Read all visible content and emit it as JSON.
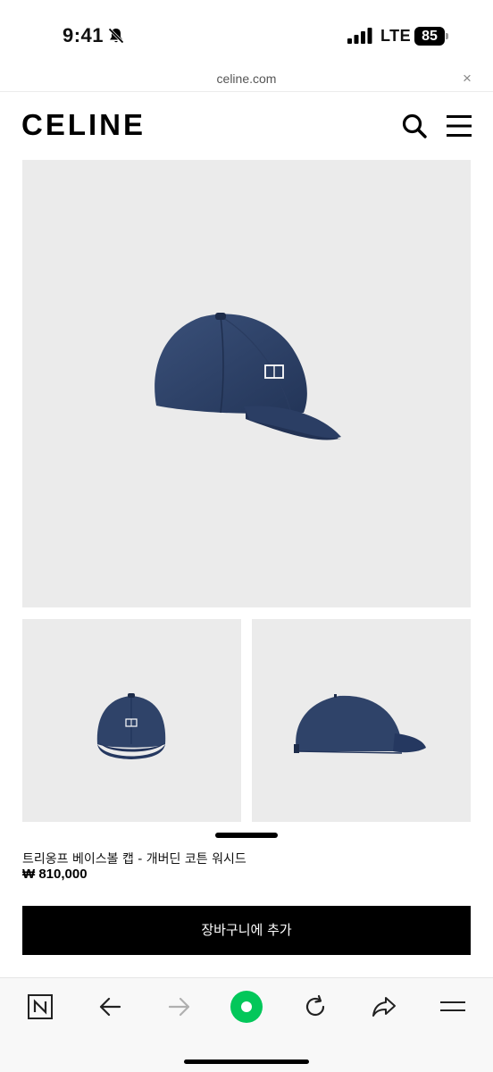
{
  "status_bar": {
    "time": "9:41",
    "network": "LTE",
    "battery": "85",
    "icons": [
      "bell-slash-icon",
      "signal-icon",
      "battery-icon"
    ]
  },
  "browser": {
    "url": "celine.com",
    "close_glyph": "×",
    "toolbar_icons": [
      "n-logo-icon",
      "back-arrow-icon",
      "forward-arrow-icon",
      "home-circle-icon",
      "reload-icon",
      "share-icon",
      "menu-icon"
    ]
  },
  "header": {
    "logo": "CELINE",
    "icons": [
      "search-icon",
      "hamburger-menu-icon"
    ]
  },
  "product": {
    "name": "트리옹프 베이스볼 캡 - 개버딘 코튼 워시드",
    "price": "₩ 810,000",
    "add_to_cart_label": "장바구니에 추가",
    "image_color": "#2e4166",
    "background_color": "#ebebeb"
  }
}
